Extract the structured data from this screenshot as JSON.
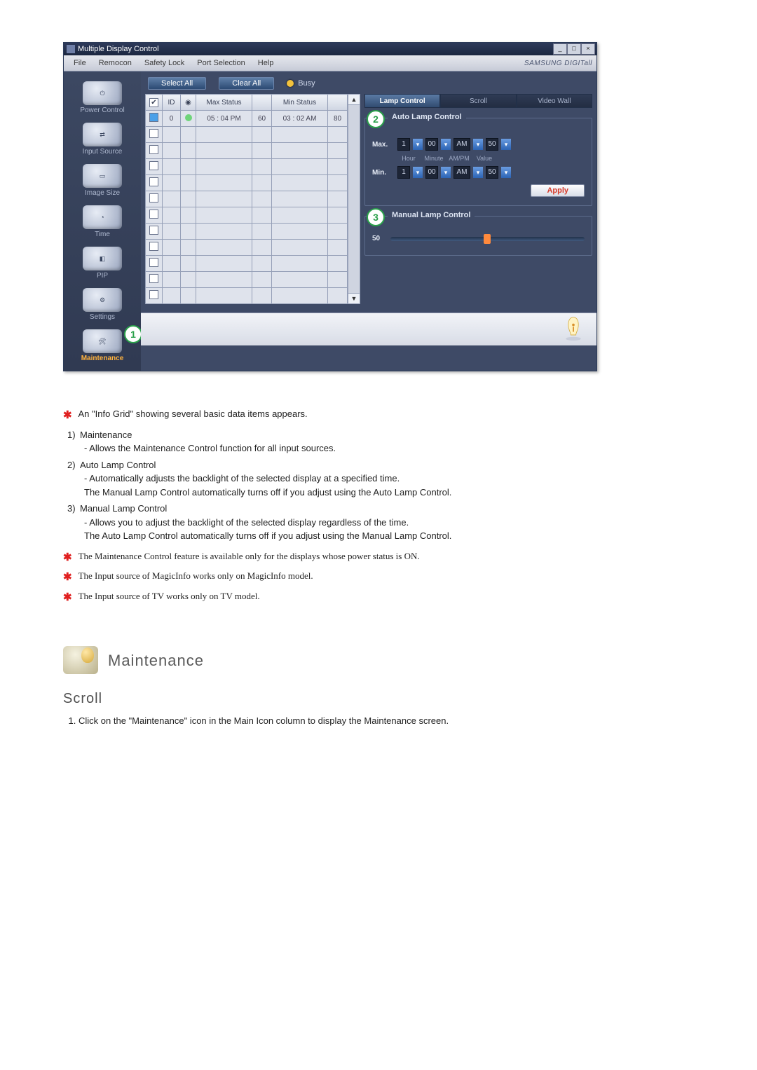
{
  "window": {
    "title": "Multiple Display Control",
    "brand": "SAMSUNG DIGITall"
  },
  "menubar": [
    "File",
    "Remocon",
    "Safety Lock",
    "Port Selection",
    "Help"
  ],
  "sidebar": {
    "items": [
      {
        "label": "Power Control"
      },
      {
        "label": "Input Source"
      },
      {
        "label": "Image Size"
      },
      {
        "label": "Time"
      },
      {
        "label": "PIP"
      },
      {
        "label": "Settings"
      },
      {
        "label": "Maintenance"
      }
    ]
  },
  "toolbar": {
    "select_all": "Select All",
    "clear_all": "Clear All",
    "busy": "Busy"
  },
  "grid": {
    "headers": [
      "",
      "ID",
      "",
      "Max Status",
      "",
      "Min Status",
      ""
    ],
    "rows": [
      {
        "checked": true,
        "id": "0",
        "status": "on",
        "max_status": "05 : 04 PM",
        "max_val": "60",
        "min_status": "03 : 02 AM",
        "min_val": "80"
      },
      {
        "checked": false,
        "id": "",
        "status": "",
        "max_status": "",
        "max_val": "",
        "min_status": "",
        "min_val": ""
      },
      {
        "checked": false,
        "id": "",
        "status": "",
        "max_status": "",
        "max_val": "",
        "min_status": "",
        "min_val": ""
      },
      {
        "checked": false,
        "id": "",
        "status": "",
        "max_status": "",
        "max_val": "",
        "min_status": "",
        "min_val": ""
      },
      {
        "checked": false,
        "id": "",
        "status": "",
        "max_status": "",
        "max_val": "",
        "min_status": "",
        "min_val": ""
      },
      {
        "checked": false,
        "id": "",
        "status": "",
        "max_status": "",
        "max_val": "",
        "min_status": "",
        "min_val": ""
      },
      {
        "checked": false,
        "id": "",
        "status": "",
        "max_status": "",
        "max_val": "",
        "min_status": "",
        "min_val": ""
      },
      {
        "checked": false,
        "id": "",
        "status": "",
        "max_status": "",
        "max_val": "",
        "min_status": "",
        "min_val": ""
      },
      {
        "checked": false,
        "id": "",
        "status": "",
        "max_status": "",
        "max_val": "",
        "min_status": "",
        "min_val": ""
      },
      {
        "checked": false,
        "id": "",
        "status": "",
        "max_status": "",
        "max_val": "",
        "min_status": "",
        "min_val": ""
      },
      {
        "checked": false,
        "id": "",
        "status": "",
        "max_status": "",
        "max_val": "",
        "min_status": "",
        "min_val": ""
      },
      {
        "checked": false,
        "id": "",
        "status": "",
        "max_status": "",
        "max_val": "",
        "min_status": "",
        "min_val": ""
      }
    ]
  },
  "right": {
    "tabs": [
      "Lamp Control",
      "Scroll",
      "Video Wall"
    ],
    "auto": {
      "title": "Auto Lamp Control",
      "col_headers": [
        "Hour",
        "Minute",
        "AM/PM",
        "Value"
      ],
      "max_label": "Max.",
      "min_label": "Min.",
      "max": {
        "hour": "1",
        "minute": "00",
        "ampm": "AM",
        "value": "50"
      },
      "min": {
        "hour": "1",
        "minute": "00",
        "ampm": "AM",
        "value": "50"
      },
      "apply": "Apply"
    },
    "manual": {
      "title": "Manual Lamp Control",
      "value": "50"
    }
  },
  "annotations": {
    "a1": "1",
    "a2": "2",
    "a3": "3"
  },
  "doc": {
    "star1": "An \"Info Grid\" showing several basic data items appears.",
    "item1_t": "Maintenance",
    "item1_s": "- Allows the Maintenance Control function for all input sources.",
    "item2_t": "Auto Lamp Control",
    "item2_s1": "- Automatically adjusts the backlight of the selected display at a specified time.",
    "item2_s2": "The Manual Lamp Control automatically turns off if you adjust using the Auto Lamp Control.",
    "item3_t": "Manual Lamp Control",
    "item3_s1": "- Allows you to adjust the backlight of the selected display regardless of the time.",
    "item3_s2": "The Auto Lamp Control automatically turns off if you adjust using the Manual Lamp Control.",
    "note1": "The Maintenance Control feature is available only for the displays whose power status is ON.",
    "note2": "The Input source of MagicInfo works only on MagicInfo model.",
    "note3": "The Input source of TV works only on TV model.",
    "section_title": "Maintenance",
    "sub_title": "Scroll",
    "scroll_step1": "Click on the \"Maintenance\" icon in the Main Icon column to display the Maintenance screen."
  }
}
